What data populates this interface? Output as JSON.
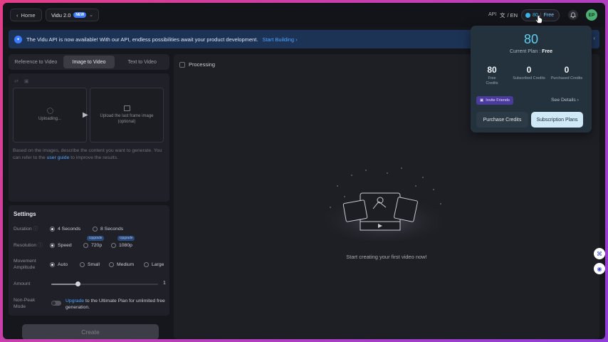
{
  "topbar": {
    "home_label": "Home",
    "model_label": "Vidu 2.0",
    "model_badge": "NEW",
    "api_label": "API",
    "lang_label": "/ EN",
    "lang_icon": "translate-icon",
    "credits": "80",
    "credit_separator": "|",
    "plan": "Free",
    "avatar_initials": "EP"
  },
  "banner": {
    "text": "The Vidu API is now available! With our API, endless possibilities await your product development.",
    "link": "Start Building"
  },
  "tabs": [
    {
      "label": "Reference to Video",
      "active": false
    },
    {
      "label": "Image to Video",
      "active": true
    },
    {
      "label": "Text to Video",
      "active": false
    }
  ],
  "upload": {
    "first_frame_status": "Uploading...",
    "last_frame_text": "Upload the last frame image (optional)",
    "prompt_pre": "Based on the images, describe the content you want to generate. You can refer to the ",
    "prompt_link": "user guide",
    "prompt_post": " to improve the results."
  },
  "settings": {
    "title": "Settings",
    "duration_label": "Duration",
    "duration_options": [
      "4 Seconds",
      "8 Seconds"
    ],
    "duration_selected": "4 Seconds",
    "resolution_label": "Resolution",
    "resolution_options": [
      "Speed",
      "720p",
      "1080p"
    ],
    "resolution_selected": "Speed",
    "upgrade_badge": "Upgrade",
    "movement_label": "Movement Amplitude",
    "movement_options": [
      "Auto",
      "Small",
      "Medium",
      "Large"
    ],
    "movement_selected": "Auto",
    "amount_label": "Amount",
    "amount_value": "1",
    "amount_fraction": 0.25,
    "nonpeak_label": "Non-Peak Mode",
    "nonpeak_link": "Upgrade",
    "nonpeak_text": " to the Ultimate Plan for unlimited free generation."
  },
  "create_label": "Create",
  "main": {
    "processing_label": "Processing",
    "empty_text": "Start creating your first video now!"
  },
  "popover": {
    "credits": "80",
    "current_plan_label": "Current Plan",
    "plan_separator": ":",
    "plan_name": "Free",
    "stats": [
      {
        "value": "80",
        "label": "Free Credits"
      },
      {
        "value": "0",
        "label": "Subscribed Credits"
      },
      {
        "value": "0",
        "label": "Purchased Credits"
      }
    ],
    "invite_label": "Invite Friends",
    "see_details": "See Details",
    "purchase_label": "Purchase Credits",
    "subscription_label": "Subscription Plans"
  },
  "colors": {
    "accent": "#4da3ff",
    "credit": "#5fd0f0",
    "background": "#16171d"
  }
}
